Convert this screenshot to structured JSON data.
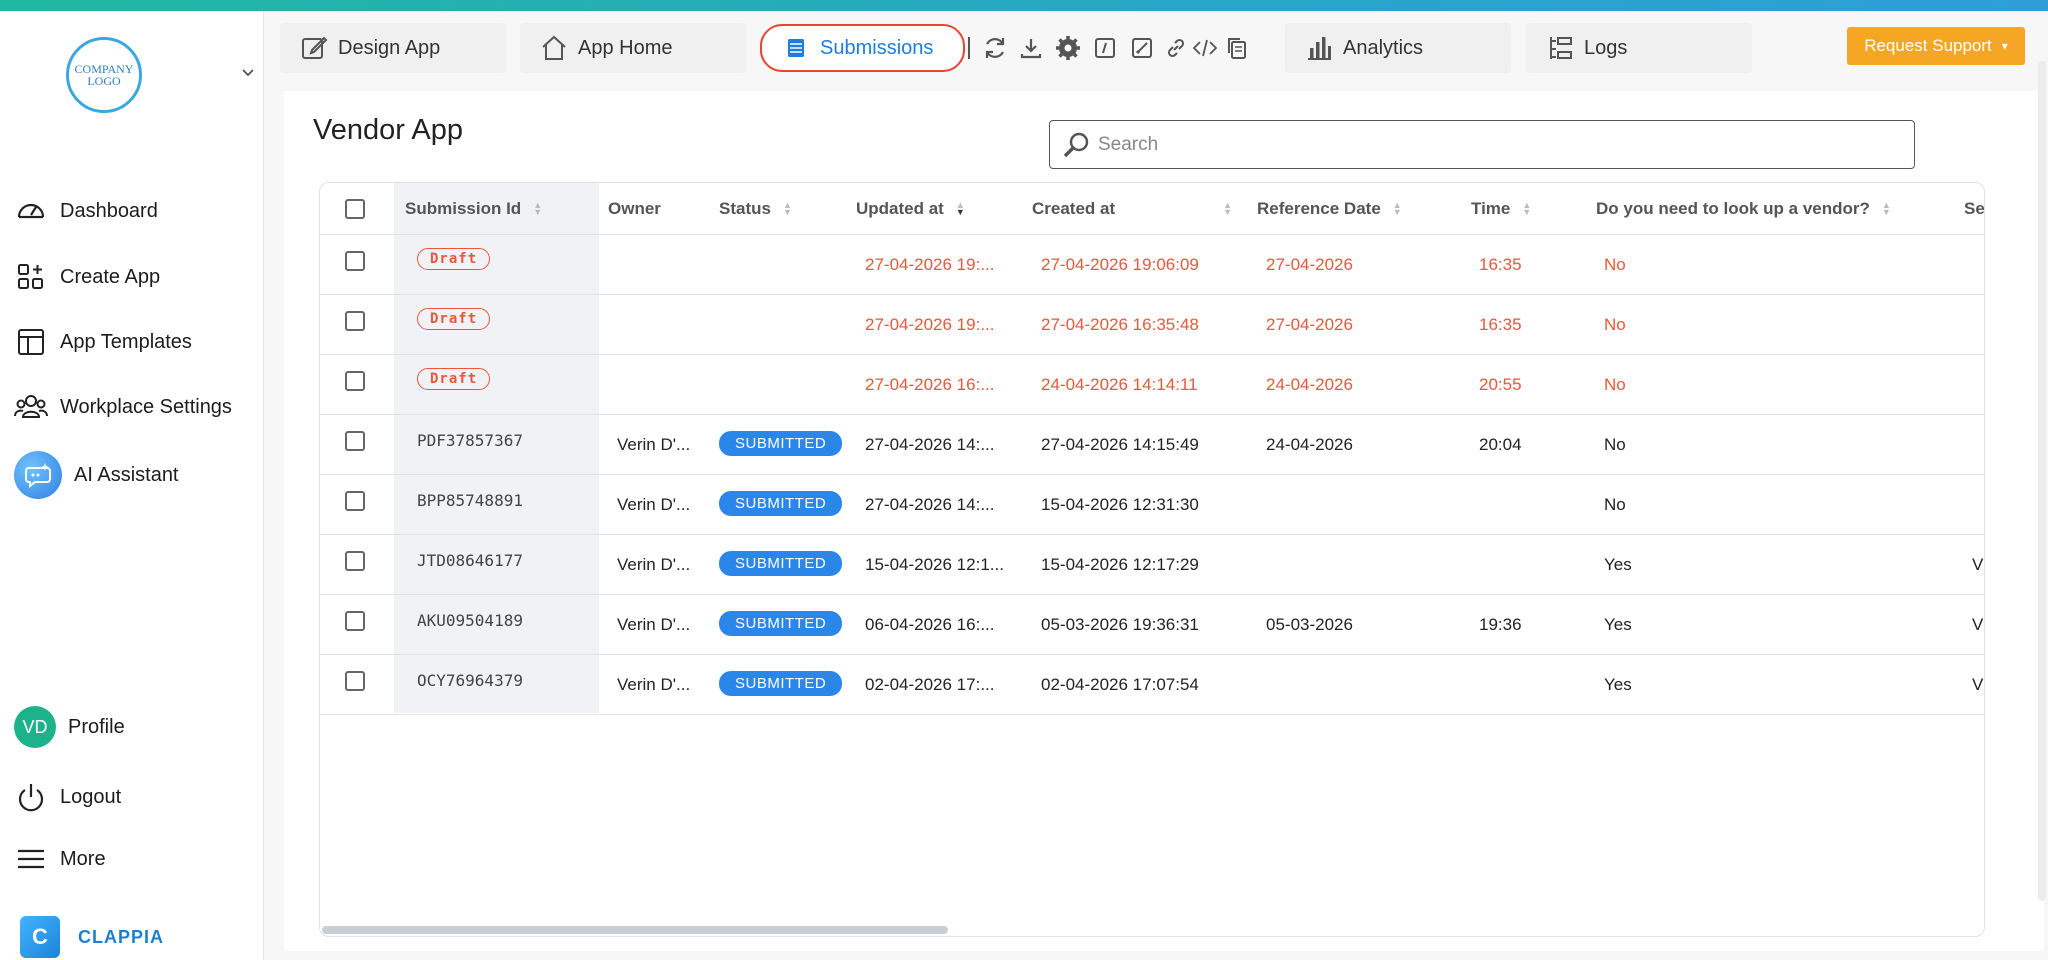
{
  "sidebar": {
    "logo_text": "COMPANY LOGO",
    "items": [
      {
        "label": "Dashboard",
        "icon": "dashboard-gauge-icon"
      },
      {
        "label": "Create App",
        "icon": "create-app-grid-icon"
      },
      {
        "label": "App Templates",
        "icon": "templates-layout-icon"
      },
      {
        "label": "Workplace Settings",
        "icon": "users-group-icon"
      },
      {
        "label": "AI Assistant",
        "icon": "ai-chat-icon"
      }
    ],
    "bottom": [
      {
        "label": "Profile",
        "avatar": "VD"
      },
      {
        "label": "Logout",
        "icon": "power-icon"
      },
      {
        "label": "More",
        "icon": "hamburger-menu-icon"
      }
    ],
    "brand_text": "CLAPPIA",
    "brand_letter": "C"
  },
  "tabs": [
    {
      "label": "Design App",
      "icon": "edit-square-icon"
    },
    {
      "label": "App Home",
      "icon": "home-icon"
    },
    {
      "label": "Submissions",
      "icon": "list-icon",
      "active": true
    },
    {
      "label": "Analytics",
      "icon": "bar-chart-icon"
    },
    {
      "label": "Logs",
      "icon": "logs-icon"
    }
  ],
  "toolbar_icons": [
    "refresh-icon",
    "download-icon",
    "settings-gear-icon",
    "page-script-icon",
    "edit-note-icon",
    "link-icon",
    "code-icon",
    "copy-icon"
  ],
  "support_button": {
    "label": "Request Support",
    "caret": "▾"
  },
  "page": {
    "title": "Vendor App",
    "search_placeholder": "Search"
  },
  "table": {
    "columns": [
      {
        "label": "Submission Id",
        "sortable": true
      },
      {
        "label": "Owner",
        "sortable": false
      },
      {
        "label": "Status",
        "sortable": true
      },
      {
        "label": "Updated at",
        "sortable": true,
        "sorted": "desc"
      },
      {
        "label": "Created at",
        "sortable": true
      },
      {
        "label": "Reference Date",
        "sortable": true
      },
      {
        "label": "Time",
        "sortable": true
      },
      {
        "label": "Do you need to look up a vendor?",
        "sortable": true
      },
      {
        "label": "Se",
        "sortable": false
      }
    ],
    "rows": [
      {
        "id": "Draft",
        "draft": true,
        "owner": "",
        "status": "",
        "updated": "27-04-2026 19:...",
        "created": "27-04-2026 19:06:09",
        "ref_date": "27-04-2026",
        "time": "16:35",
        "lookup": "No",
        "extra": ""
      },
      {
        "id": "Draft",
        "draft": true,
        "owner": "",
        "status": "",
        "updated": "27-04-2026 19:...",
        "created": "27-04-2026 16:35:48",
        "ref_date": "27-04-2026",
        "time": "16:35",
        "lookup": "No",
        "extra": ""
      },
      {
        "id": "Draft",
        "draft": true,
        "owner": "",
        "status": "",
        "updated": "27-04-2026 16:...",
        "created": "24-04-2026 14:14:11",
        "ref_date": "24-04-2026",
        "time": "20:55",
        "lookup": "No",
        "extra": ""
      },
      {
        "id": "PDF37857367",
        "draft": false,
        "owner": "Verin D'...",
        "status": "SUBMITTED",
        "updated": "27-04-2026 14:...",
        "created": "27-04-2026 14:15:49",
        "ref_date": "24-04-2026",
        "time": "20:04",
        "lookup": "No",
        "extra": ""
      },
      {
        "id": "BPP85748891",
        "draft": false,
        "owner": "Verin D'...",
        "status": "SUBMITTED",
        "updated": "27-04-2026 14:...",
        "created": "15-04-2026 12:31:30",
        "ref_date": "",
        "time": "",
        "lookup": "No",
        "extra": ""
      },
      {
        "id": "JTD08646177",
        "draft": false,
        "owner": "Verin D'...",
        "status": "SUBMITTED",
        "updated": "15-04-2026 12:1...",
        "created": "15-04-2026 12:17:29",
        "ref_date": "",
        "time": "",
        "lookup": "Yes",
        "extra": "V·"
      },
      {
        "id": "AKU09504189",
        "draft": false,
        "owner": "Verin D'...",
        "status": "SUBMITTED",
        "updated": "06-04-2026 16:...",
        "created": "05-03-2026 19:36:31",
        "ref_date": "05-03-2026",
        "time": "19:36",
        "lookup": "Yes",
        "extra": "V·"
      },
      {
        "id": "OCY76964379",
        "draft": false,
        "owner": "Verin D'...",
        "status": "SUBMITTED",
        "updated": "02-04-2026 17:...",
        "created": "02-04-2026 17:07:54",
        "ref_date": "",
        "time": "",
        "lookup": "Yes",
        "extra": "V·"
      }
    ]
  },
  "colors": {
    "accent": "#1e7ee0",
    "draft": "#e9573b",
    "submitted": "#2a86e8",
    "support": "#f5a623"
  }
}
